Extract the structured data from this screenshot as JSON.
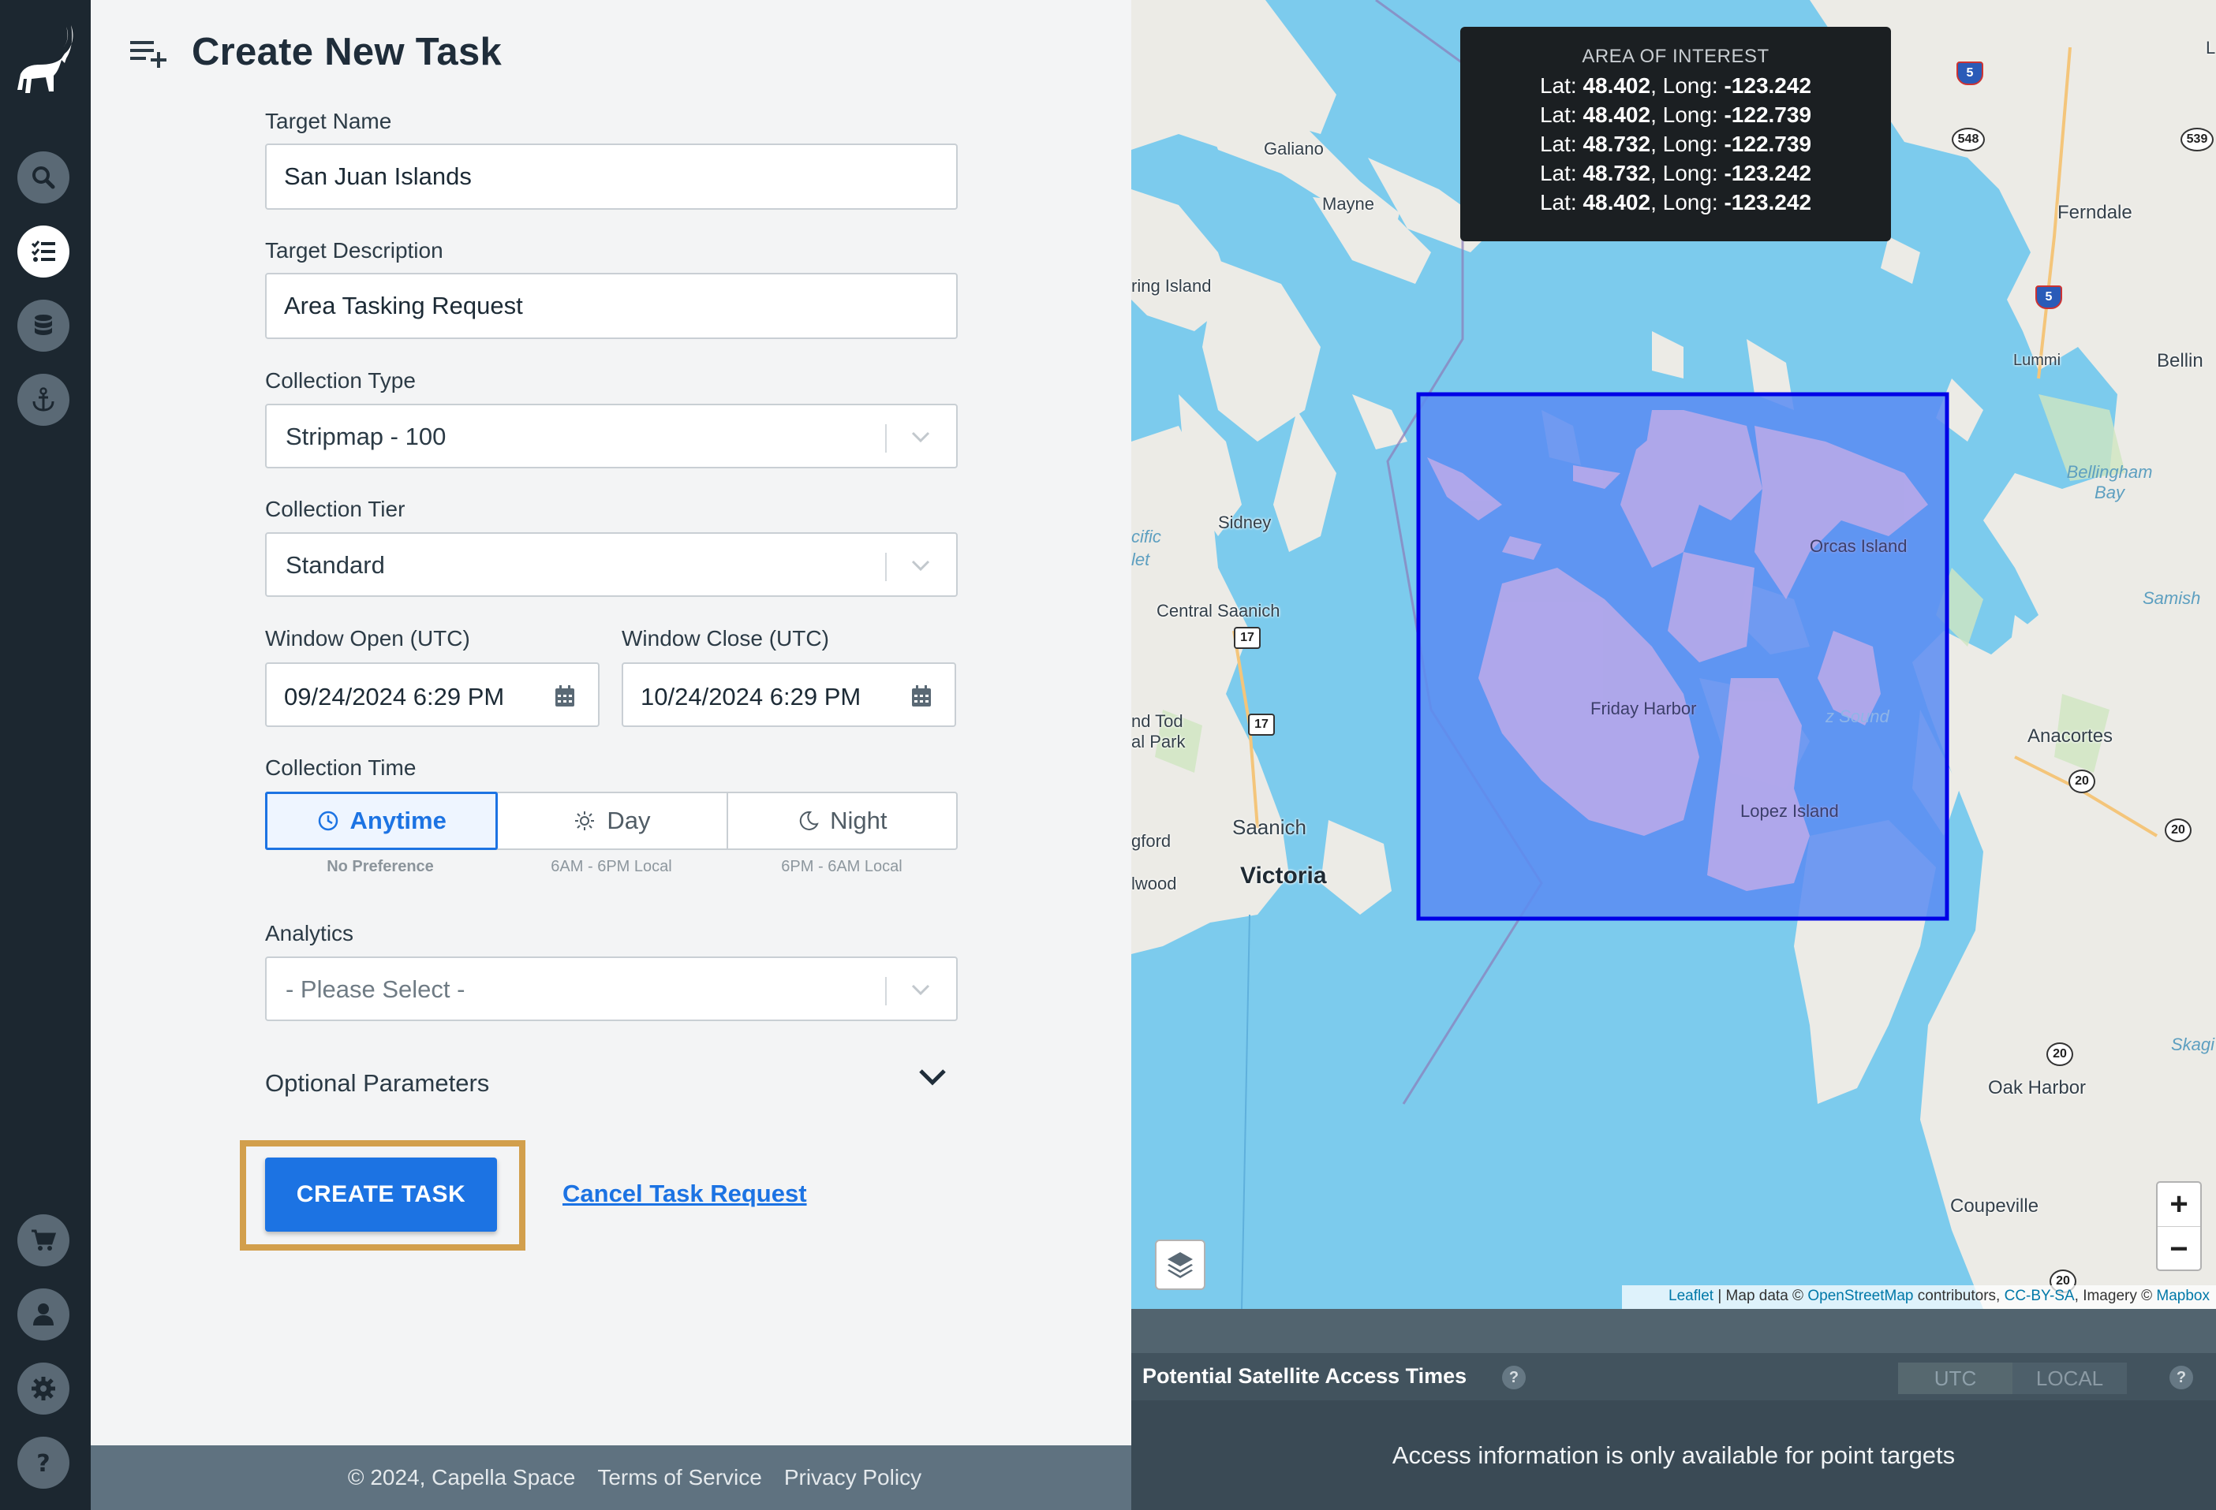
{
  "app": {
    "title": "Create New Task"
  },
  "sidebar": {
    "items": [
      {
        "name": "search",
        "icon": "search-icon"
      },
      {
        "name": "tasks",
        "icon": "task-list-icon",
        "active": true
      },
      {
        "name": "data",
        "icon": "database-icon"
      },
      {
        "name": "anchor",
        "icon": "anchor-icon"
      },
      {
        "name": "cart",
        "icon": "cart-icon"
      },
      {
        "name": "account",
        "icon": "user-icon"
      },
      {
        "name": "settings",
        "icon": "gear-icon"
      },
      {
        "name": "help",
        "icon": "help-icon"
      }
    ]
  },
  "form": {
    "target_name": {
      "label": "Target Name",
      "value": "San Juan Islands"
    },
    "target_description": {
      "label": "Target Description",
      "value": "Area Tasking Request"
    },
    "collection_type": {
      "label": "Collection Type",
      "value": "Stripmap - 100"
    },
    "collection_tier": {
      "label": "Collection Tier",
      "value": "Standard"
    },
    "window_open": {
      "label": "Window Open (UTC)",
      "value": "09/24/2024 6:29 PM"
    },
    "window_close": {
      "label": "Window Close (UTC)",
      "value": "10/24/2024 6:29 PM"
    },
    "collection_time": {
      "label": "Collection Time",
      "options": [
        {
          "label": "Anytime",
          "sub": "No Preference",
          "selected": true
        },
        {
          "label": "Day",
          "sub": "6AM - 6PM Local"
        },
        {
          "label": "Night",
          "sub": "6PM - 6AM Local"
        }
      ]
    },
    "analytics": {
      "label": "Analytics",
      "placeholder": "- Please Select -"
    },
    "optional_parameters": "Optional Parameters",
    "create_button": "CREATE TASK",
    "cancel_link": "Cancel Task Request"
  },
  "footer": {
    "copyright": "© 2024, Capella Space",
    "terms": "Terms of Service",
    "privacy": "Privacy Policy"
  },
  "map": {
    "aoi": {
      "title": "AREA OF INTEREST",
      "points": [
        {
          "lat": "48.402",
          "long": "-123.242"
        },
        {
          "lat": "48.402",
          "long": "-122.739"
        },
        {
          "lat": "48.732",
          "long": "-122.739"
        },
        {
          "lat": "48.732",
          "long": "-123.242"
        },
        {
          "lat": "48.402",
          "long": "-123.242"
        }
      ]
    },
    "labels": {
      "galiano": "Galiano",
      "mayne": "Mayne",
      "spring_island": "ring Island",
      "sidney": "Sidney",
      "central_saanich": "Central Saanich",
      "tod_park_1": "nd Tod",
      "tod_park_2": "al Park",
      "saanich": "Saanich",
      "victoria": "Victoria",
      "langford": "gford",
      "colwood": "lwood",
      "friday_harbor": "Friday Harbor",
      "orcas_island": "Orcas Island",
      "lopez_island": "Lopez Island",
      "ferndale": "Ferndale",
      "bellingham": "Bellin",
      "lummi": "Lummi",
      "bellingham_bay": "Bellingham Bay",
      "samish": "Samish",
      "anacortes": "Anacortes",
      "oak_harbor": "Oak Harbor",
      "coupeville": "Coupeville",
      "skagit": "Skagi",
      "sound": "z Sound",
      "pacific": "cific",
      "inlet": "let"
    },
    "shields": {
      "hwy17a": "17",
      "hwy17b": "17",
      "i5a": "5",
      "i5b": "5",
      "sr548": "548",
      "sr539": "539",
      "sr20a": "20",
      "sr20b": "20",
      "sr20c": "20",
      "sr20d": "20",
      "edge_l": "L"
    },
    "zoom_in": "+",
    "zoom_out": "−",
    "attribution": {
      "leaflet": "Leaflet",
      "sep1": " | Map data © ",
      "osm": "OpenStreetMap",
      "contrib": " contributors, ",
      "license": "CC-BY-SA",
      "imagery": ", Imagery © ",
      "mapbox": "Mapbox"
    },
    "colors": {
      "water": "#7ccbed",
      "land": "#ecebe6",
      "aoi_fill": "#5a8cf2",
      "aoi_stroke": "#0000e6"
    }
  },
  "access": {
    "title": "Potential Satellite Access Times",
    "help": "?",
    "tz_utc": "UTC",
    "tz_local": "LOCAL",
    "message": "Access information is only available for point targets"
  },
  "colors": {
    "primary": "#1c73e3",
    "sidebar": "#1c2730",
    "highlight": "#d29f4c"
  }
}
